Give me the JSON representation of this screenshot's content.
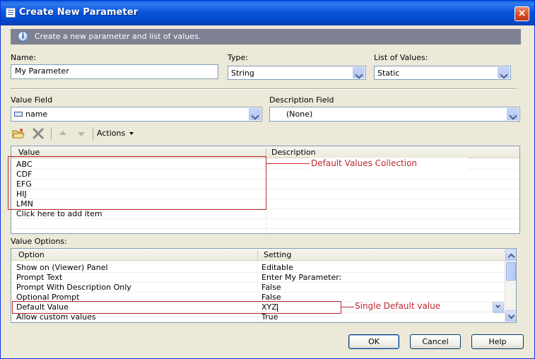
{
  "window": {
    "title": "Create New Parameter",
    "close_label": "×"
  },
  "info": {
    "text": "Create a new parameter and list of values.",
    "icon": "info-icon"
  },
  "fields": {
    "name_label": "Name:",
    "name_value": "My Parameter",
    "type_label": "Type:",
    "type_value": "String",
    "lov_label": "List of Values:",
    "lov_value": "Static",
    "value_field_label": "Value Field",
    "value_field_value": "name",
    "description_field_label": "Description Field",
    "description_field_value": "(None)"
  },
  "toolbar": {
    "actions_label": "Actions"
  },
  "values_grid": {
    "headers": [
      "Value",
      "Description"
    ],
    "rows": [
      {
        "value": "ABC",
        "description": ""
      },
      {
        "value": "CDF",
        "description": ""
      },
      {
        "value": "EFG",
        "description": ""
      },
      {
        "value": "HIJ",
        "description": ""
      },
      {
        "value": "LMN",
        "description": ""
      }
    ],
    "add_item_text": "Click here to add item"
  },
  "value_options": {
    "label": "Value Options:",
    "headers": [
      "Option",
      "Setting"
    ],
    "rows": [
      {
        "option": "Show on (Viewer) Panel",
        "setting": "Editable"
      },
      {
        "option": "Prompt Text",
        "setting": "Enter My Parameter:"
      },
      {
        "option": "Prompt With Description Only",
        "setting": "False"
      },
      {
        "option": "Optional Prompt",
        "setting": "False"
      },
      {
        "option": "Default Value",
        "setting": "XYZ"
      },
      {
        "option": "Allow custom values",
        "setting": "True"
      }
    ]
  },
  "annotations": {
    "default_values": "Default Values Collection",
    "single_default": "Single Default value",
    "color": "#c0282d"
  },
  "buttons": {
    "ok": "OK",
    "cancel": "Cancel",
    "help": "Help"
  }
}
